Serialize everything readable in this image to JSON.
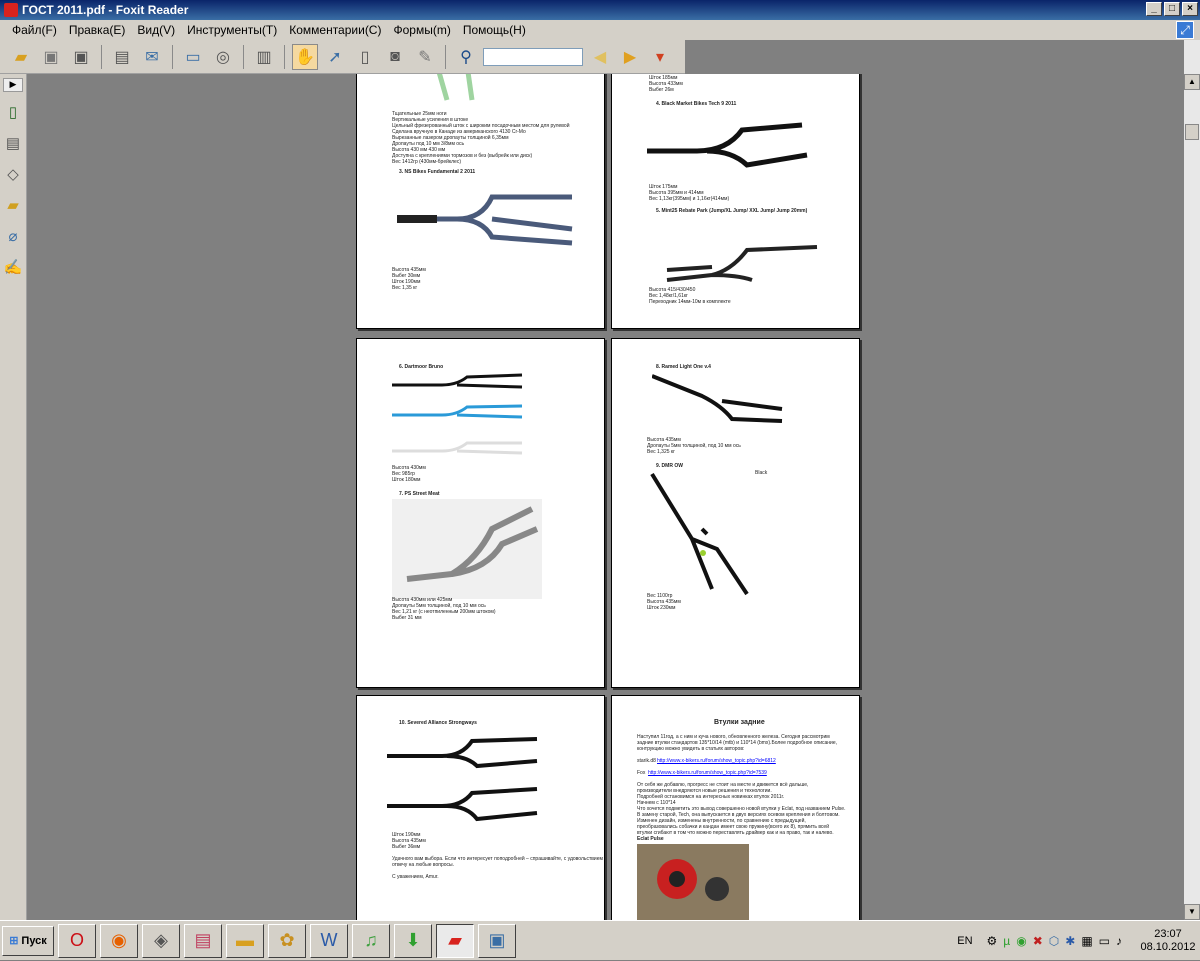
{
  "window": {
    "title": "ГОСТ 2011.pdf - Foxit Reader",
    "btn_min": "_",
    "btn_max": "□",
    "btn_close": "×"
  },
  "menu": [
    "Файл(F)",
    "Правка(E)",
    "Вид(V)",
    "Инструменты(T)",
    "Комментарии(C)",
    "Формы(m)",
    "Помощь(H)"
  ],
  "toolbar": {
    "search_value": ""
  },
  "pages": {
    "p1": {
      "lines": [
        "Тщательные 25мм ноги",
        "Вертикальные усиления в штоке",
        "Цельный фрезерованный шток с широким посадочным местом для рулевой",
        "Сделана вручную в Канаде из американского 4130 Cr-Mo",
        "Вырезанные лазером дропауты толщиной 6,35мм",
        "Дропауты под 10 мм 3/8мм ось",
        "Высота 430 мм 430 мм",
        "Доступна с креплениями тормозов и без (выбрейк или диск)",
        "Вес 1412гр (430мм-брейклес)"
      ],
      "heading": "3.   NS Bikes Fundamental 2 2011",
      "specs": [
        "Высота 435мм",
        "Выбег 30мм",
        "Шток 190мм",
        "Вес 1,35 кг"
      ]
    },
    "p2": {
      "top": [
        "Шток 185мм",
        "Высота 433мм",
        "Выбег 26м"
      ],
      "heading1": "4.   Black Market Bikes Tech 9 2011",
      "specs1": [
        "Шток 175мм",
        "Высота 395мм и 414мм",
        "Вес 1,13кг(395мм) и 1,16кг(414мм)"
      ],
      "heading2": "5.   Mint25 Rebate Park (Jump/XL Jump/ XXL Jump/ Jump 20mm)",
      "specs2": [
        "Высота 415/430/450",
        "Вес 1,48кг/1,61кг",
        "Переходник 14мм-10м в комплекте"
      ]
    },
    "p3": {
      "heading1": "6.   Dartmoor Bruno",
      "specs1": [
        "Высота 430мм",
        "Вес 985гр",
        "Шток 180мм"
      ],
      "heading2": "7.   PS Street Meat",
      "specs2": [
        "Высота 430мм или 425мм",
        "Дропауты 5мм толщиной, под 10 мм ось",
        "Вес 1,21 кг (с неотпиленным  200мм штоком)",
        "Выбег 31 мм"
      ]
    },
    "p4": {
      "heading1": "8.   Ramed Light One v.4",
      "specs1": [
        "Высота 435мм",
        "Дропауты 5мм толщиной, под 10 мм ось",
        "Вес 1,325 кг"
      ],
      "heading2": "9.   DMR OW",
      "label": "Black",
      "specs2": [
        "Вес 1100гр",
        "Высота 435мм",
        "Шток 230мм"
      ]
    },
    "p5": {
      "heading": "10. Severed Alliance Strongways",
      "specs": [
        "Шток 190мм",
        "Высота 435мм",
        "Выбег 36мм"
      ],
      "footer1": "Удачного вам выбора. Если что интересует поподробней – спрашивайте, с удовольствием",
      "footer2": "отвечу на любые вопросы.",
      "sign": "С уважением, Amur."
    },
    "p6": {
      "title": "Втулки задние",
      "para": [
        "Наступил 11год, а с ним и куча нового, обновленного железа. Сегодня рассмотрим",
        "задние втулки стандартов 135*10/14 (mtb) и 110*14 (bmx).Более подробное описание,",
        "контрукцию можно увидеть в статьях  авторов:"
      ],
      "link1_label": "starik.d8",
      "link1": "http://www.x-bikers.ru/forum/show_topic.php?id=6812",
      "link2_label": "Fox",
      "link2": "http://www.x-bikers.ru/forum/show_topic.php?id=7539",
      "para2": [
        "От себя же добавлю, прогресс не стоит на месте и движется всё дальше,",
        "производители внедряются новые решения и технологии.",
        "Подробней остановимся на интересных новинках втулок 2011г.",
        "Начнем с 110*14",
        "Что хочется подметить это выход совершенно новой втулки у Eclat, под названием Pulse.",
        "В замену старой, Tech, она выпускается в двух версиях осевом крепления и болтовом.",
        "Изменен дизайн, изменены внутренности, по сравнению с предыдущей,",
        "преобразовались собачки и кандан имеет свою пружину(всего их 8), прямить всей",
        "втулки сгибают в том что можно переставлять драйвер как и на право, так и налево.",
        "Eclat Pulse"
      ]
    }
  },
  "taskbar": {
    "start": "Пуск",
    "lang": "EN",
    "time": "23:07",
    "date": "08.10.2012"
  }
}
